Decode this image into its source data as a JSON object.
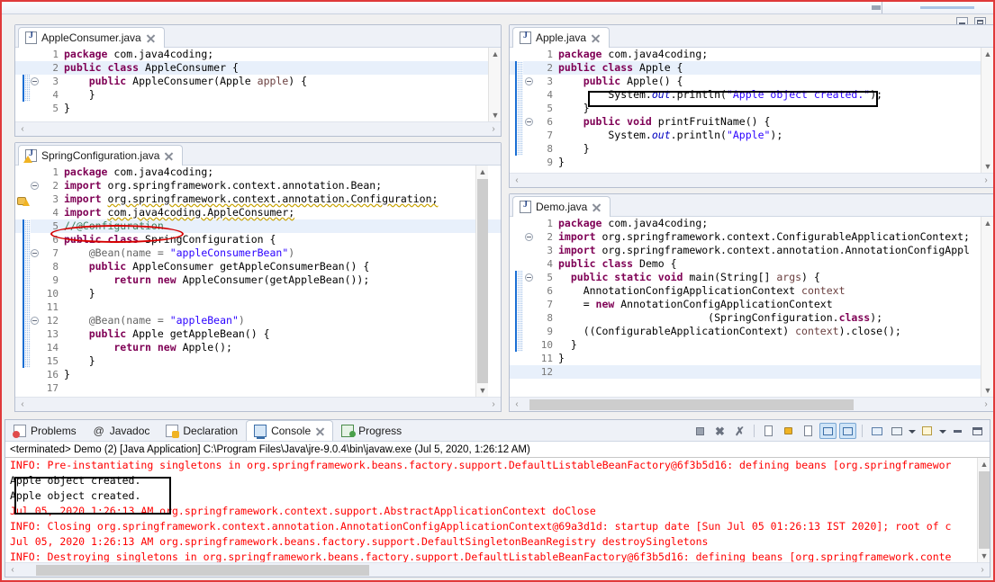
{
  "window": {
    "title_strip": "",
    "min_label": "Minimize",
    "max_label": "Maximize"
  },
  "editors": [
    {
      "id": "apple-consumer",
      "tab_label": "AppleConsumer.java",
      "icon": "java-file-icon",
      "dirty": false,
      "lines": [
        {
          "n": "1",
          "fold": false,
          "change": false,
          "hl": false,
          "tokens": [
            {
              "t": "package ",
              "c": "kw"
            },
            {
              "t": "com.java4coding;",
              "c": "pln"
            }
          ]
        },
        {
          "n": "2",
          "fold": false,
          "change": false,
          "hl": true,
          "tokens": [
            {
              "t": "public class ",
              "c": "kw"
            },
            {
              "t": "AppleConsumer {",
              "c": "pln"
            }
          ]
        },
        {
          "n": "3",
          "fold": true,
          "change": true,
          "hl": false,
          "tokens": [
            {
              "t": "    public ",
              "c": "kw"
            },
            {
              "t": "AppleConsumer(Apple ",
              "c": "pln"
            },
            {
              "t": "apple",
              "c": "loc"
            },
            {
              "t": ") {",
              "c": "pln"
            }
          ]
        },
        {
          "n": "4",
          "fold": false,
          "change": true,
          "hl": false,
          "tokens": [
            {
              "t": "    }",
              "c": "pln"
            }
          ]
        },
        {
          "n": "5",
          "fold": false,
          "change": false,
          "hl": false,
          "tokens": [
            {
              "t": "}",
              "c": "pln"
            }
          ]
        }
      ]
    },
    {
      "id": "spring-configuration",
      "tab_label": "SpringConfiguration.java",
      "icon": "java-file-warning-icon",
      "gutter_warning": "warning-marker-icon",
      "lines": [
        {
          "n": "1",
          "fold": false,
          "change": false,
          "hl": false,
          "tokens": [
            {
              "t": "package ",
              "c": "kw"
            },
            {
              "t": "com.java4coding;",
              "c": "pln"
            }
          ]
        },
        {
          "n": "2",
          "fold": true,
          "change": false,
          "hl": false,
          "tokens": [
            {
              "t": "import ",
              "c": "kw"
            },
            {
              "t": "org.springframework.context.annotation.Bean;",
              "c": "pln"
            }
          ]
        },
        {
          "n": "3",
          "fold": false,
          "change": false,
          "hl": false,
          "tokens": [
            {
              "t": "import ",
              "c": "kw"
            },
            {
              "t": "org.springframework.context.annotation.Configuration;",
              "c": "undl"
            }
          ]
        },
        {
          "n": "4",
          "fold": false,
          "change": false,
          "hl": false,
          "tokens": [
            {
              "t": "import ",
              "c": "kw"
            },
            {
              "t": "com.java4coding.AppleConsumer;",
              "c": "undl"
            }
          ]
        },
        {
          "n": "5",
          "fold": false,
          "change": true,
          "hl": true,
          "tokens": [
            {
              "t": "//@Configuration",
              "c": "cmt"
            }
          ]
        },
        {
          "n": "6",
          "fold": false,
          "change": true,
          "hl": false,
          "tokens": [
            {
              "t": "public class ",
              "c": "kw"
            },
            {
              "t": "SpringConfiguration {",
              "c": "pln"
            }
          ]
        },
        {
          "n": "7",
          "fold": true,
          "change": true,
          "hl": false,
          "tokens": [
            {
              "t": "    @Bean(name = ",
              "c": "ann"
            },
            {
              "t": "\"appleConsumerBean\"",
              "c": "str"
            },
            {
              "t": ")",
              "c": "ann"
            }
          ]
        },
        {
          "n": "8",
          "fold": false,
          "change": true,
          "hl": false,
          "tokens": [
            {
              "t": "    public ",
              "c": "kw"
            },
            {
              "t": "AppleConsumer getAppleConsumerBean() {",
              "c": "pln"
            }
          ]
        },
        {
          "n": "9",
          "fold": false,
          "change": true,
          "hl": false,
          "tokens": [
            {
              "t": "        return new ",
              "c": "kw"
            },
            {
              "t": "AppleConsumer(getAppleBean());",
              "c": "pln"
            }
          ]
        },
        {
          "n": "10",
          "fold": false,
          "change": true,
          "hl": false,
          "tokens": [
            {
              "t": "    }",
              "c": "pln"
            }
          ]
        },
        {
          "n": "11",
          "fold": false,
          "change": true,
          "hl": false,
          "tokens": [
            {
              "t": "",
              "c": "pln"
            }
          ]
        },
        {
          "n": "12",
          "fold": true,
          "change": true,
          "hl": false,
          "tokens": [
            {
              "t": "    @Bean(name = ",
              "c": "ann"
            },
            {
              "t": "\"appleBean\"",
              "c": "str"
            },
            {
              "t": ")",
              "c": "ann"
            }
          ]
        },
        {
          "n": "13",
          "fold": false,
          "change": true,
          "hl": false,
          "tokens": [
            {
              "t": "    public ",
              "c": "kw"
            },
            {
              "t": "Apple getAppleBean() {",
              "c": "pln"
            }
          ]
        },
        {
          "n": "14",
          "fold": false,
          "change": true,
          "hl": false,
          "tokens": [
            {
              "t": "        return new ",
              "c": "kw"
            },
            {
              "t": "Apple();",
              "c": "pln"
            }
          ]
        },
        {
          "n": "15",
          "fold": false,
          "change": true,
          "hl": false,
          "tokens": [
            {
              "t": "    }",
              "c": "pln"
            }
          ]
        },
        {
          "n": "16",
          "fold": false,
          "change": true,
          "hl": false,
          "tokens": [
            {
              "t": "}",
              "c": "pln"
            }
          ]
        },
        {
          "n": "17",
          "fold": false,
          "change": false,
          "hl": false,
          "tokens": [
            {
              "t": "",
              "c": "pln"
            }
          ]
        }
      ]
    },
    {
      "id": "apple",
      "tab_label": "Apple.java",
      "icon": "java-file-icon",
      "lines": [
        {
          "n": "1",
          "fold": false,
          "change": false,
          "hl": false,
          "tokens": [
            {
              "t": "package ",
              "c": "kw"
            },
            {
              "t": "com.java4coding;",
              "c": "pln"
            }
          ]
        },
        {
          "n": "2",
          "fold": false,
          "change": true,
          "hl": true,
          "tokens": [
            {
              "t": "public class ",
              "c": "kw"
            },
            {
              "t": "Apple {",
              "c": "pln"
            }
          ]
        },
        {
          "n": "3",
          "fold": true,
          "change": true,
          "hl": false,
          "tokens": [
            {
              "t": "    public ",
              "c": "kw"
            },
            {
              "t": "Apple() {",
              "c": "pln"
            }
          ]
        },
        {
          "n": "4",
          "fold": false,
          "change": true,
          "hl": false,
          "tokens": [
            {
              "t": "        System.",
              "c": "pln"
            },
            {
              "t": "out",
              "c": "fld"
            },
            {
              "t": ".println(",
              "c": "pln"
            },
            {
              "t": "\"Apple object created.\"",
              "c": "str"
            },
            {
              "t": ");",
              "c": "pln"
            }
          ]
        },
        {
          "n": "5",
          "fold": false,
          "change": true,
          "hl": false,
          "tokens": [
            {
              "t": "    }",
              "c": "pln"
            }
          ]
        },
        {
          "n": "6",
          "fold": true,
          "change": true,
          "hl": false,
          "tokens": [
            {
              "t": "    public void ",
              "c": "kw"
            },
            {
              "t": "printFruitName() {",
              "c": "pln"
            }
          ]
        },
        {
          "n": "7",
          "fold": false,
          "change": true,
          "hl": false,
          "tokens": [
            {
              "t": "        System.",
              "c": "pln"
            },
            {
              "t": "out",
              "c": "fld"
            },
            {
              "t": ".println(",
              "c": "pln"
            },
            {
              "t": "\"Apple\"",
              "c": "str"
            },
            {
              "t": ");",
              "c": "pln"
            }
          ]
        },
        {
          "n": "8",
          "fold": false,
          "change": true,
          "hl": false,
          "tokens": [
            {
              "t": "    }",
              "c": "pln"
            }
          ]
        },
        {
          "n": "9",
          "fold": false,
          "change": false,
          "hl": false,
          "tokens": [
            {
              "t": "}",
              "c": "pln"
            }
          ]
        }
      ]
    },
    {
      "id": "demo",
      "tab_label": "Demo.java",
      "icon": "java-file-icon",
      "lines": [
        {
          "n": "1",
          "fold": false,
          "change": false,
          "hl": false,
          "tokens": [
            {
              "t": "package ",
              "c": "kw"
            },
            {
              "t": "com.java4coding;",
              "c": "pln"
            }
          ]
        },
        {
          "n": "2",
          "fold": true,
          "change": false,
          "hl": false,
          "tokens": [
            {
              "t": "import ",
              "c": "kw"
            },
            {
              "t": "org.springframework.context.ConfigurableApplicationContext;",
              "c": "pln"
            }
          ]
        },
        {
          "n": "3",
          "fold": false,
          "change": false,
          "hl": false,
          "tokens": [
            {
              "t": "import ",
              "c": "kw"
            },
            {
              "t": "org.springframework.context.annotation.AnnotationConfigAppl",
              "c": "pln"
            }
          ]
        },
        {
          "n": "4",
          "fold": false,
          "change": false,
          "hl": false,
          "tokens": [
            {
              "t": "public class ",
              "c": "kw"
            },
            {
              "t": "Demo {",
              "c": "pln"
            }
          ]
        },
        {
          "n": "5",
          "fold": true,
          "change": true,
          "hl": false,
          "tokens": [
            {
              "t": "  public static void ",
              "c": "kw"
            },
            {
              "t": "main(String[] ",
              "c": "pln"
            },
            {
              "t": "args",
              "c": "loc"
            },
            {
              "t": ") {",
              "c": "pln"
            }
          ]
        },
        {
          "n": "6",
          "fold": false,
          "change": true,
          "hl": false,
          "tokens": [
            {
              "t": "    AnnotationConfigApplicationContext ",
              "c": "pln"
            },
            {
              "t": "context",
              "c": "loc"
            }
          ]
        },
        {
          "n": "7",
          "fold": false,
          "change": true,
          "hl": false,
          "tokens": [
            {
              "t": "    = ",
              "c": "pln"
            },
            {
              "t": "new ",
              "c": "kw"
            },
            {
              "t": "AnnotationConfigApplicationContext",
              "c": "pln"
            }
          ]
        },
        {
          "n": "8",
          "fold": false,
          "change": true,
          "hl": false,
          "tokens": [
            {
              "t": "                        (SpringConfiguration.",
              "c": "pln"
            },
            {
              "t": "class",
              "c": "kw"
            },
            {
              "t": ");",
              "c": "pln"
            }
          ]
        },
        {
          "n": "9",
          "fold": false,
          "change": true,
          "hl": false,
          "tokens": [
            {
              "t": "    ((ConfigurableApplicationContext) ",
              "c": "pln"
            },
            {
              "t": "context",
              "c": "loc"
            },
            {
              "t": ").close();",
              "c": "pln"
            }
          ]
        },
        {
          "n": "10",
          "fold": false,
          "change": true,
          "hl": false,
          "tokens": [
            {
              "t": "  }",
              "c": "pln"
            }
          ]
        },
        {
          "n": "11",
          "fold": false,
          "change": false,
          "hl": false,
          "tokens": [
            {
              "t": "}",
              "c": "pln"
            }
          ]
        },
        {
          "n": "12",
          "fold": false,
          "change": false,
          "hl": true,
          "tokens": [
            {
              "t": "",
              "c": "pln"
            }
          ]
        }
      ]
    }
  ],
  "bottom_view": {
    "tabs": [
      {
        "label": "Problems",
        "icon": "problems-icon",
        "active": false,
        "close": false
      },
      {
        "label": "Javadoc",
        "icon": "javadoc-icon",
        "active": false,
        "close": false
      },
      {
        "label": "Declaration",
        "icon": "declaration-icon",
        "active": false,
        "close": false
      },
      {
        "label": "Console",
        "icon": "console-icon",
        "active": true,
        "close": true
      },
      {
        "label": "Progress",
        "icon": "progress-icon",
        "active": false,
        "close": false
      }
    ],
    "toolbar": [
      {
        "name": "terminate-button",
        "icon": "stop-square-icon",
        "toggled": false
      },
      {
        "name": "remove-launch-button",
        "icon": "gray-x-icon",
        "toggled": false
      },
      {
        "name": "remove-all-launches-button",
        "icon": "double-gray-x-icon",
        "toggled": false
      },
      {
        "name": "separator-1",
        "icon": "separator",
        "toggled": false
      },
      {
        "name": "clear-console-button",
        "icon": "clear-page-icon",
        "toggled": false
      },
      {
        "name": "scroll-lock-button",
        "icon": "padlock-icon",
        "toggled": false
      },
      {
        "name": "word-wrap-button",
        "icon": "wrap-page-icon",
        "toggled": false
      },
      {
        "name": "show-console-on-output-button",
        "icon": "console-out-icon",
        "toggled": true
      },
      {
        "name": "show-console-on-error-button",
        "icon": "console-error-icon",
        "toggled": true
      },
      {
        "name": "separator-2",
        "icon": "separator",
        "toggled": false
      },
      {
        "name": "pin-console-button",
        "icon": "pin-console-icon",
        "toggled": false
      },
      {
        "name": "display-selected-console-button",
        "icon": "monitor-icon",
        "toggled": false
      },
      {
        "name": "display-selected-console-dropdown",
        "icon": "chevron-down-icon",
        "toggled": false
      },
      {
        "name": "open-console-button",
        "icon": "new-console-icon",
        "toggled": false
      },
      {
        "name": "open-console-dropdown",
        "icon": "chevron-down-icon",
        "toggled": false
      },
      {
        "name": "minimize-view-button",
        "icon": "minimize-icon",
        "toggled": false
      },
      {
        "name": "maximize-view-button",
        "icon": "maximize-icon",
        "toggled": false
      }
    ],
    "launch_header": "<terminated> Demo (2) [Java Application] C:\\Program Files\\Java\\jre-9.0.4\\bin\\javaw.exe (Jul 5, 2020, 1:26:12 AM)",
    "console_lines": [
      {
        "text": "INFO: Pre-instantiating singletons in org.springframework.beans.factory.support.DefaultListableBeanFactory@6f3b5d16: defining beans [org.springframewor",
        "color": "red"
      },
      {
        "text": "Apple object created.",
        "color": "black"
      },
      {
        "text": "Apple object created.",
        "color": "black"
      },
      {
        "text": "Jul 05, 2020 1:26:13 AM org.springframework.context.support.AbstractApplicationContext doClose",
        "color": "red"
      },
      {
        "text": "INFO: Closing org.springframework.context.annotation.AnnotationConfigApplicationContext@69a3d1d: startup date [Sun Jul 05 01:26:13 IST 2020]; root of c",
        "color": "red"
      },
      {
        "text": "Jul 05, 2020 1:26:13 AM org.springframework.beans.factory.support.DefaultSingletonBeanRegistry destroySingletons",
        "color": "red"
      },
      {
        "text": "INFO: Destroying singletons in org.springframework.beans.factory.support.DefaultListableBeanFactory@6f3b5d16: defining beans [org.springframework.conte",
        "color": "red"
      }
    ]
  },
  "annotations": {
    "ellipse_label": "red-ellipse-highlight-configuration-comment",
    "box_apple_println_label": "black-box-highlight-println",
    "box_console_label": "black-box-highlight-apple-object-created"
  },
  "colors": {
    "accent_red": "#e03a3a",
    "keyword": "#7f0055",
    "string": "#2a00ff",
    "comment": "#3f7f5f",
    "console_error": "#ff0000"
  }
}
